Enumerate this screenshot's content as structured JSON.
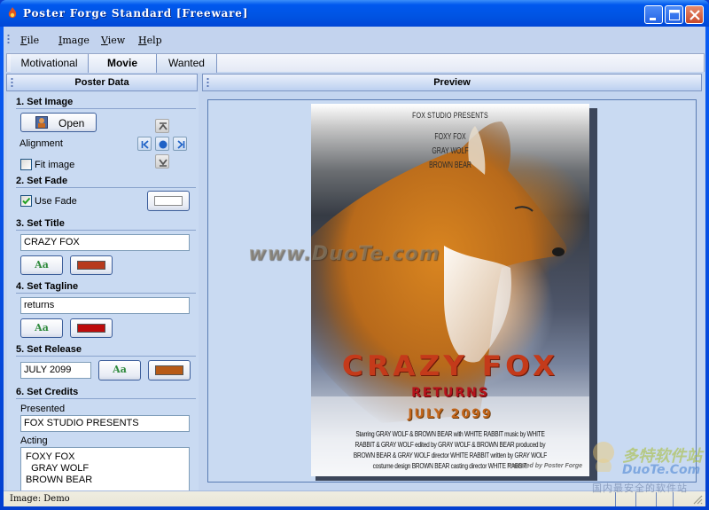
{
  "window": {
    "title": "Poster Forge Standard [Freeware]",
    "controls": [
      "minimize",
      "maximize",
      "close"
    ]
  },
  "menu": {
    "items": [
      {
        "label": "File",
        "mnemonic": "F"
      },
      {
        "label": "Image",
        "mnemonic": "I"
      },
      {
        "label": "View",
        "mnemonic": "V"
      },
      {
        "label": "Help",
        "mnemonic": "H"
      }
    ]
  },
  "tabs": [
    {
      "label": "Motivational",
      "active": false
    },
    {
      "label": "Movie",
      "active": true
    },
    {
      "label": "Wanted",
      "active": false
    }
  ],
  "left_panel": {
    "title": "Poster Data",
    "set_image": {
      "heading": "1. Set Image",
      "open_label": "Open",
      "alignment_label": "Alignment",
      "fit_image_label": "Fit image",
      "fit_image_checked": false,
      "alignment_buttons": [
        "align-top",
        "align-left",
        "align-center",
        "align-right",
        "align-bottom"
      ]
    },
    "set_fade": {
      "heading": "2. Set Fade",
      "use_fade_label": "Use Fade",
      "use_fade_checked": true,
      "fade_color": "#ffffff"
    },
    "set_title": {
      "heading": "3. Set Title",
      "value": "CRAZY FOX",
      "font_label": "Aa",
      "color": "#b73a1c"
    },
    "set_tagline": {
      "heading": "4. Set Tagline",
      "value": "returns",
      "font_label": "Aa",
      "color": "#bd0b0b"
    },
    "set_release": {
      "heading": "5. Set Release",
      "value": "JULY 2099",
      "font_label": "Aa",
      "color": "#b75a16"
    },
    "set_credits": {
      "heading": "6. Set Credits",
      "presented_label": "Presented",
      "presented_value": "FOX STUDIO PRESENTS",
      "acting_label": "Acting",
      "acting_lines": [
        "FOXY FOX",
        "  GRAY WOLF",
        "BROWN BEAR"
      ]
    }
  },
  "preview": {
    "title": "Preview",
    "poster": {
      "presents": "FOX STUDIO PRESENTS",
      "cast": [
        "FOXY FOX",
        "GRAY WOLF",
        "BROWN BEAR"
      ],
      "title": "CRAZY FOX",
      "tagline": "RETURNS",
      "release": "JULY 2099",
      "credits": "Starring GRAY WOLF & BROWN BEAR with WHITE RABBIT music by WHITE RABBIT & GRAY WOLF edited by GRAY WOLF & BROWN BEAR produced by BROWN BEAR & GRAY WOLF director WHITE RABBIT written by GRAY WOLF costume design BROWN BEAR casting director WHITE RABBIT.",
      "powered_by": "Powered by Poster Forge"
    },
    "watermark": "www.DuoTe.com"
  },
  "status": {
    "text": "Image: Demo"
  },
  "corner_logo": {
    "cn_name": "多特软件站",
    "en_name": "DuoTe.Com",
    "slogan": "国内最安全的软件站"
  }
}
